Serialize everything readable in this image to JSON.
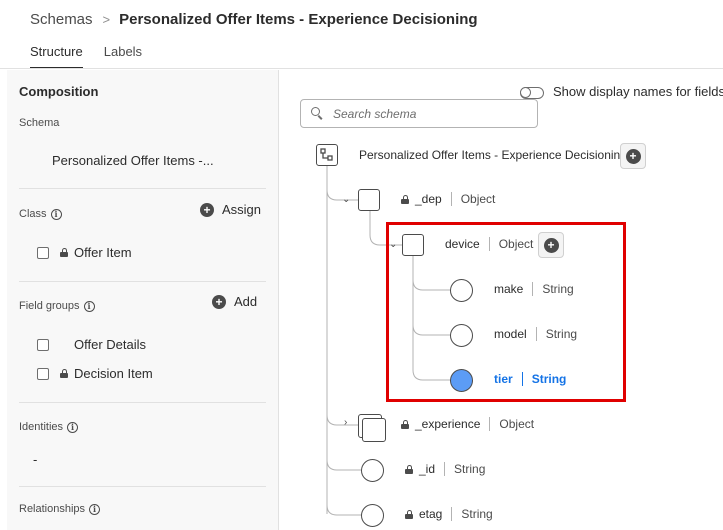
{
  "breadcrumb": {
    "parent": "Schemas",
    "separator": ">",
    "current": "Personalized Offer Items - Experience Decisioning"
  },
  "tabs": [
    {
      "label": "Structure",
      "active": true
    },
    {
      "label": "Labels",
      "active": false
    }
  ],
  "left_panel": {
    "title": "Composition",
    "schema": {
      "label": "Schema",
      "name": "Personalized Offer Items -..."
    },
    "class": {
      "label": "Class",
      "action": "Assign",
      "items": [
        {
          "name": "Offer Item",
          "locked": true,
          "checked": false
        }
      ]
    },
    "field_groups": {
      "label": "Field groups",
      "action": "Add",
      "items": [
        {
          "name": "Offer Details",
          "locked": false,
          "checked": false
        },
        {
          "name": "Decision Item",
          "locked": true,
          "checked": false
        }
      ]
    },
    "identities": {
      "label": "Identities",
      "value": "-"
    },
    "relationships": {
      "label": "Relationships"
    }
  },
  "right_panel": {
    "toggle_label": "Show display names for fields",
    "toggle_on": false,
    "search_placeholder": "Search schema",
    "root": {
      "name": "Personalized Offer Items - Experience Decisioning"
    },
    "nodes": {
      "dep": {
        "name": "_dep",
        "type": "Object"
      },
      "device": {
        "name": "device",
        "type": "Object"
      },
      "make": {
        "name": "make",
        "type": "String"
      },
      "model": {
        "name": "model",
        "type": "String"
      },
      "tier": {
        "name": "tier",
        "type": "String",
        "selected": true
      },
      "experience": {
        "name": "_experience",
        "type": "Object"
      },
      "id": {
        "name": "_id",
        "type": "String"
      },
      "etag": {
        "name": "etag",
        "type": "String"
      }
    }
  },
  "colors": {
    "selected": "#1473e6",
    "selected_fill": "#5c9cf5",
    "highlight": "#e00000"
  }
}
